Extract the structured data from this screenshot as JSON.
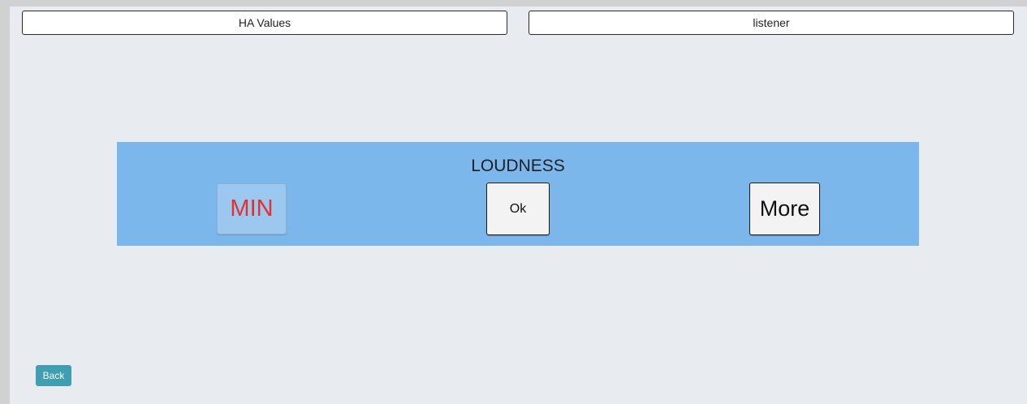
{
  "tabs": {
    "left_label": "HA Values",
    "right_label": "listener"
  },
  "loudness_panel": {
    "title": "LOUDNESS",
    "min_label": "MIN",
    "ok_label": "Ok",
    "more_label": "More"
  },
  "footer": {
    "back_label": "Back"
  },
  "colors": {
    "background": "#e8ebf0",
    "panel": "#7cb7ec",
    "min_text": "#e0322e",
    "back_button": "#3f9eb1"
  }
}
